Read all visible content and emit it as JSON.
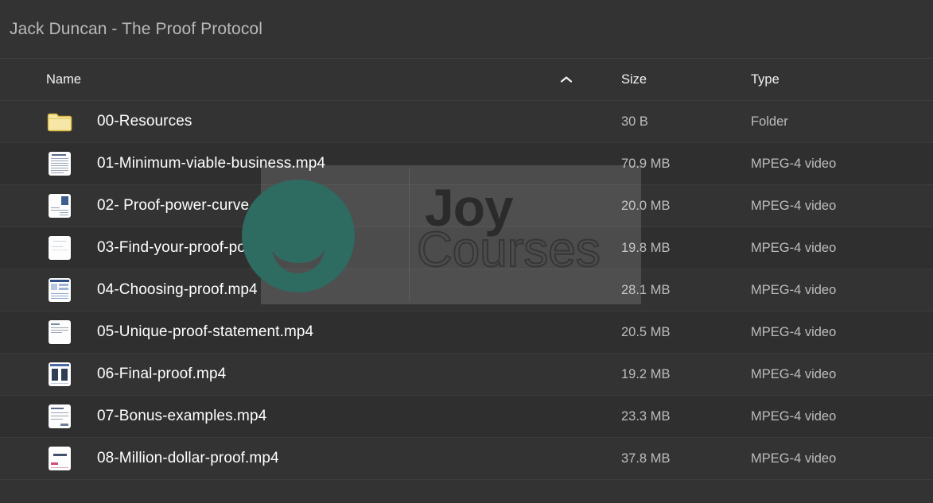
{
  "window": {
    "title": "Jack Duncan - The Proof Protocol",
    "background_color": "#333333"
  },
  "table": {
    "columns": {
      "name": "Name",
      "size": "Size",
      "type": "Type"
    },
    "sort": {
      "column": "Name",
      "direction": "ascending",
      "icon": "chevron-up-icon"
    },
    "rows": [
      {
        "icon": "folder-icon",
        "name": "00-Resources",
        "size": "30 B",
        "type": "Folder"
      },
      {
        "icon": "document-icon",
        "name": "01-Minimum-viable-business.mp4",
        "size": "70.9 MB",
        "type": "MPEG-4 video"
      },
      {
        "icon": "document-icon",
        "name": "02- Proof-power-curve.mp4",
        "size": "20.0 MB",
        "type": "MPEG-4 video"
      },
      {
        "icon": "document-icon",
        "name": "03-Find-your-proof-power.mp4",
        "size": "19.8 MB",
        "type": "MPEG-4 video"
      },
      {
        "icon": "document-icon",
        "name": "04-Choosing-proof.mp4",
        "size": "28.1 MB",
        "type": "MPEG-4 video"
      },
      {
        "icon": "document-icon",
        "name": "05-Unique-proof-statement.mp4",
        "size": "20.5 MB",
        "type": "MPEG-4 video"
      },
      {
        "icon": "document-icon",
        "name": "06-Final-proof.mp4",
        "size": "19.2 MB",
        "type": "MPEG-4 video"
      },
      {
        "icon": "document-icon",
        "name": "07-Bonus-examples.mp4",
        "size": "23.3 MB",
        "type": "MPEG-4 video"
      },
      {
        "icon": "document-icon",
        "name": "08-Million-dollar-proof.mp4",
        "size": "37.8 MB",
        "type": "MPEG-4 video"
      }
    ]
  },
  "watermark": {
    "brand_primary": "Joy",
    "brand_secondary": "Courses",
    "logo_color": "#2e6b60"
  }
}
